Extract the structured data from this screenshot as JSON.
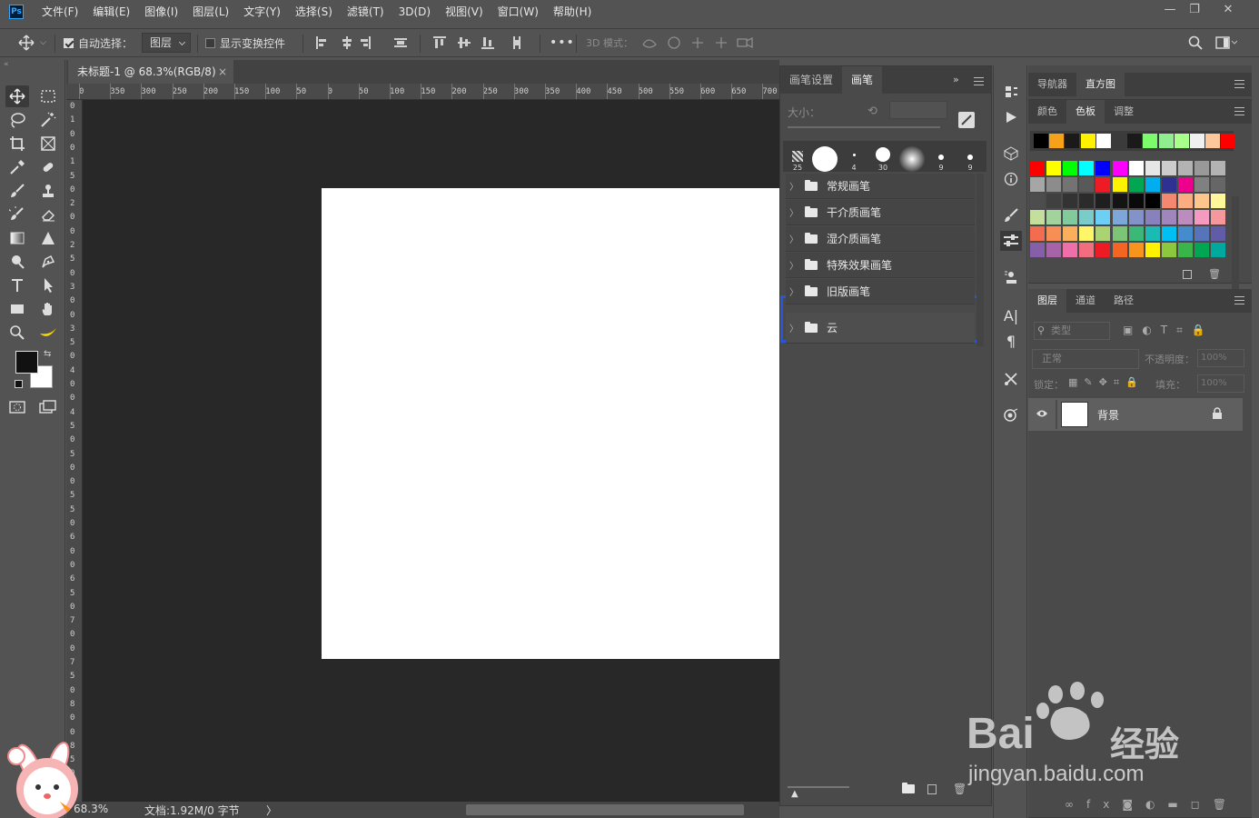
{
  "app": {
    "logo": "Ps"
  },
  "menubar": {
    "items": [
      "文件(F)",
      "编辑(E)",
      "图像(I)",
      "图层(L)",
      "文字(Y)",
      "选择(S)",
      "滤镜(T)",
      "3D(D)",
      "视图(V)",
      "窗口(W)",
      "帮助(H)"
    ],
    "window_controls": [
      "minimize-icon",
      "restore-icon",
      "close-icon"
    ]
  },
  "options": {
    "auto_select_label": "自动选择：",
    "auto_select_checked": true,
    "auto_select_target": "图层",
    "show_transform_label": "显示变换控件",
    "show_transform_checked": false,
    "more_label": "•••",
    "mode_3d_label": "3D 模式："
  },
  "document": {
    "tab_title": "未标题-1 @ 68.3%(RGB/8) *",
    "tab_close": "×",
    "ruler_top": [
      "0",
      "350",
      "300",
      "250",
      "200",
      "150",
      "100",
      "50",
      "0",
      "50",
      "100",
      "150",
      "200",
      "250",
      "300",
      "350",
      "400",
      "450",
      "500",
      "550",
      "600",
      "650",
      "700"
    ],
    "ruler_left": [
      "0",
      "1",
      "0",
      "0",
      "1",
      "5",
      "0",
      "2",
      "0",
      "0",
      "2",
      "5",
      "0",
      "3",
      "0",
      "0",
      "3",
      "5",
      "0",
      "4",
      "0",
      "0",
      "4",
      "5",
      "0",
      "5",
      "0",
      "0",
      "5",
      "5",
      "0",
      "6",
      "0",
      "0",
      "6",
      "5",
      "0",
      "7",
      "0",
      "0",
      "7",
      "5",
      "0",
      "8",
      "0",
      "0",
      "8",
      "5",
      "0"
    ],
    "zoom_status": "68.3%",
    "doc_size": "文档:1.92M/0 字节",
    "status_arrow": "〉"
  },
  "brush_panel": {
    "tabs": [
      "画笔设置",
      "画笔"
    ],
    "active_tab": "画笔",
    "size_label": "大小：",
    "preset_sizes": [
      "25",
      "",
      "4",
      "30",
      "",
      "9",
      "9"
    ],
    "groups": [
      "常规画笔",
      "干介质画笔",
      "湿介质画笔",
      "特殊效果画笔",
      "旧版画笔",
      "云"
    ],
    "highlighted_group": "云",
    "highlight_color": "#2b55d8"
  },
  "right": {
    "top_tabs": [
      "导航器",
      "直方图"
    ],
    "top_active": "直方图",
    "color_tabs": [
      "颜色",
      "色板",
      "调整"
    ],
    "color_active": "色板",
    "recent_swatches": [
      "#000000",
      "#f7a11a",
      "#1a1a1a",
      "#fff200",
      "#ffffff",
      "#3b3b3b",
      "#1a1a1a",
      "#7cfc6c",
      "#90ee90",
      "#a8ff8a",
      "#f0f0f0",
      "#fcc79b",
      "#ff0000"
    ],
    "swatches": [
      [
        "#ff0000",
        "#ffff00",
        "#00ff00",
        "#00ffff",
        "#0000ff",
        "#ff00ff",
        "#ffffff",
        "#e6e6e6",
        "#cccccc",
        "#b3b3b3",
        "#999999",
        "#b3b3b3"
      ],
      [
        "#a6a6a6",
        "#8c8c8c",
        "#737373",
        "#595959",
        "#ed1c24",
        "#fff200",
        "#00a651",
        "#00aeef",
        "#2e3192",
        "#ec008c",
        "#808080",
        "#666666"
      ],
      [
        "#4d4d4d",
        "#404040",
        "#333333",
        "#2b2b2b",
        "#1f1f1f",
        "#141414",
        "#0a0a0a",
        "#000000",
        "#f4876f",
        "#f9ad81",
        "#fdc68a",
        "#fff799"
      ],
      [
        "#c4df9b",
        "#a3d39c",
        "#82ca9c",
        "#7accc8",
        "#6dcff6",
        "#7da7d9",
        "#8393ca",
        "#8781bd",
        "#a186be",
        "#bd8cbf",
        "#f49ac1",
        "#f5989d"
      ],
      [
        "#f26c4f",
        "#f68e56",
        "#fbaf5d",
        "#fff568",
        "#acd373",
        "#7cc576",
        "#3bb878",
        "#1abbb4",
        "#00bff3",
        "#448ccb",
        "#5574b9",
        "#605ca8"
      ],
      [
        "#855fa8",
        "#a763a8",
        "#f06eaa",
        "#f26d7d",
        "#ed1c24",
        "#f26522",
        "#f7941d",
        "#fff200",
        "#8dc63f",
        "#39b54a",
        "#00a651",
        "#00a99d"
      ]
    ],
    "layers_tabs": [
      "图层",
      "通道",
      "路径"
    ],
    "layers_active": "图层",
    "filter_label": "类型",
    "blend_mode": "正常",
    "opacity_label": "不透明度：",
    "opacity_value": "100%",
    "lock_label": "锁定：",
    "fill_label": "填充：",
    "fill_value": "100%",
    "layer_name": "背景"
  },
  "watermark": {
    "brand": "Bai",
    "brand2": "经验",
    "url": "jingyan.baidu.com"
  }
}
